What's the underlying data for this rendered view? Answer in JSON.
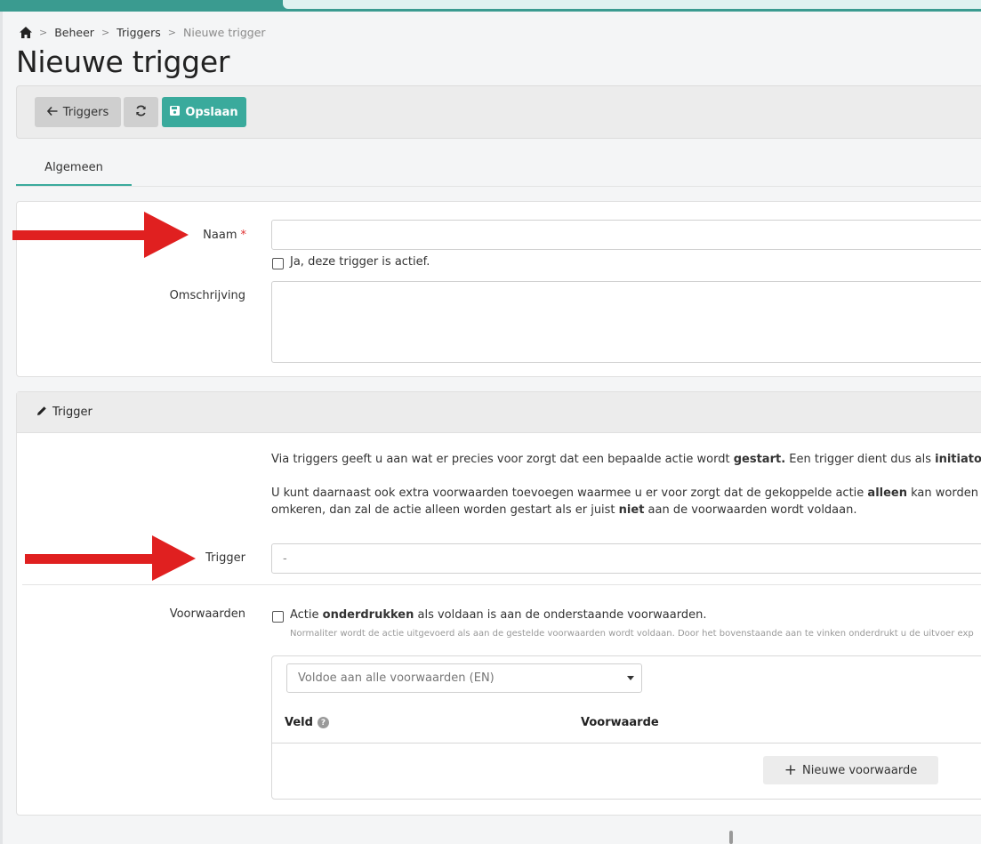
{
  "breadcrumb": {
    "items": [
      "Beheer",
      "Triggers"
    ],
    "current": "Nieuwe trigger",
    "separator": ">"
  },
  "page": {
    "title": "Nieuwe trigger"
  },
  "toolbar": {
    "back_label": "Triggers",
    "save_label": "Opslaan"
  },
  "tabs": [
    {
      "label": "Algemeen",
      "active": true
    }
  ],
  "general": {
    "name_label": "Naam",
    "required_marker": "*",
    "name_value": "",
    "active_label": "Ja, deze trigger is actief.",
    "active_checked": false,
    "description_label": "Omschrijving",
    "description_value": ""
  },
  "trigger_card": {
    "header": "Trigger",
    "intro_1": {
      "a": "Via triggers geeft u aan wat er precies voor zorgt dat een bepaalde actie wordt ",
      "b": "gestart.",
      "c": " Een trigger dient dus als ",
      "d": "initiator var"
    },
    "intro_2": {
      "a": "U kunt daarnaast ook extra voorwaarden toevoegen waarmee u er voor zorgt dat de gekoppelde actie ",
      "b": "alleen",
      "c": " kan worden ge"
    },
    "intro_3": {
      "a": "omkeren, dan zal de actie alleen worden gestart als er juist ",
      "b": "niet",
      "c": " aan de voorwaarden wordt voldaan."
    },
    "trigger_label": "Trigger",
    "trigger_value": "-",
    "conditions_label": "Voorwaarden",
    "suppress": {
      "a": "Actie ",
      "b": "onderdrukken",
      "c": " als voldaan is aan de onderstaande voorwaarden.",
      "checked": false
    },
    "suppress_hint": "Normaliter wordt de actie uitgevoerd als aan de gestelde voorwaarden wordt voldaan. Door het bovenstaande aan te vinken onderdrukt u de uitvoer exp",
    "match_select": "Voldoe aan alle voorwaarden (EN)",
    "col_field": "Veld",
    "col_condition": "Voorwaarde",
    "help_glyph": "?",
    "new_condition_label": "Nieuwe voorwaarde"
  },
  "colors": {
    "accent": "#3aaa9c",
    "topbar": "#3a9b90",
    "annotation_arrow": "#e02020",
    "required": "#e03030"
  }
}
